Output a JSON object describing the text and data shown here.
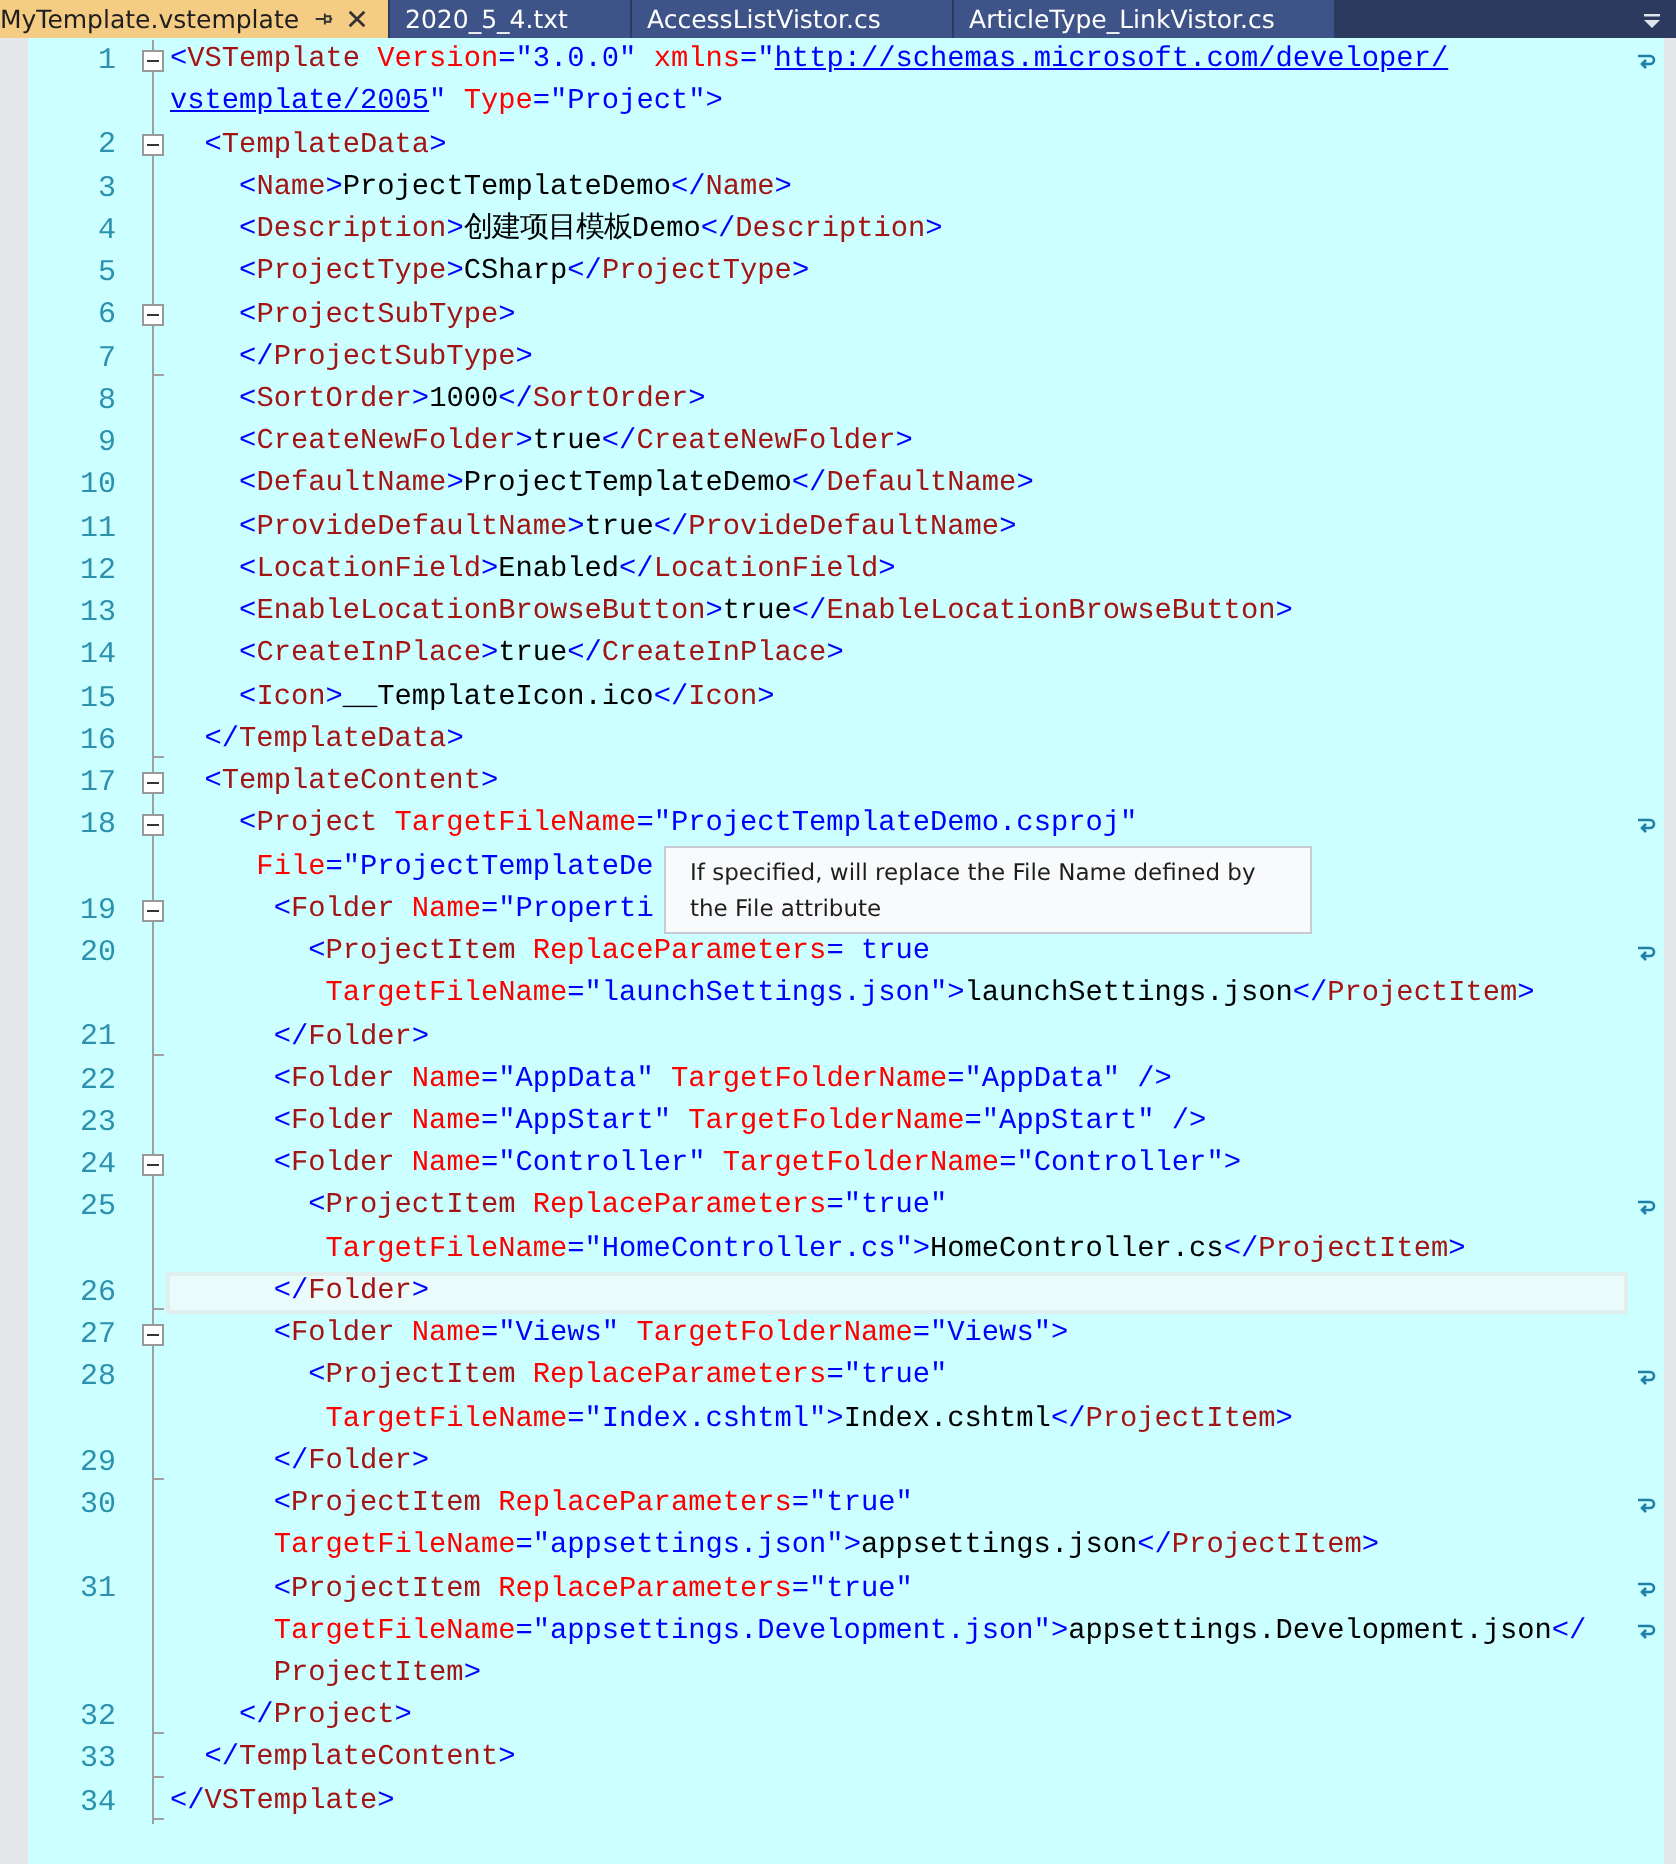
{
  "tabs": [
    {
      "label": "MyTemplate.vstemplate",
      "selected": true
    },
    {
      "label": "2020_5_4.txt",
      "selected": false
    },
    {
      "label": "AccessListVistor.cs",
      "selected": false
    },
    {
      "label": "ArticleType_LinkVistor.cs",
      "selected": false
    }
  ],
  "lines": [
    {
      "n": "1",
      "kind": "open",
      "current": false,
      "rows": [
        {
          "tokens": [
            {
              "kind": "punct",
              "text": "<"
            },
            {
              "kind": "element",
              "text": "VSTemplate"
            },
            {
              "kind": "attr",
              "text": " Version"
            },
            {
              "kind": "punct",
              "text": "="
            },
            {
              "kind": "value",
              "text": "\"3.0.0\""
            },
            {
              "kind": "attr",
              "text": " xmlns"
            },
            {
              "kind": "punct",
              "text": "="
            },
            {
              "kind": "value",
              "text": "\""
            },
            {
              "kind": "link",
              "text": "http://schemas.microsoft.com/developer/"
            }
          ]
        },
        {
          "tokens": [
            {
              "kind": "link",
              "text": "vstemplate/2005"
            },
            {
              "kind": "value",
              "text": "\""
            },
            {
              "kind": "attr",
              "text": " Type"
            },
            {
              "kind": "punct",
              "text": "="
            },
            {
              "kind": "value",
              "text": "\"Project\""
            },
            {
              "kind": "punct",
              "text": ">"
            }
          ]
        }
      ]
    },
    {
      "n": "2",
      "kind": "open",
      "current": false,
      "rows": [
        {
          "tokens": [
            {
              "kind": "punct",
              "text": "  <"
            },
            {
              "kind": "element",
              "text": "TemplateData"
            },
            {
              "kind": "punct",
              "text": ">"
            }
          ]
        }
      ]
    },
    {
      "n": "3",
      "kind": "plain",
      "current": false,
      "rows": [
        {
          "tokens": [
            {
              "kind": "punct",
              "text": "    <"
            },
            {
              "kind": "element",
              "text": "Name"
            },
            {
              "kind": "punct",
              "text": ">"
            },
            {
              "kind": "text",
              "text": "ProjectTemplateDemo"
            },
            {
              "kind": "punct",
              "text": "</"
            },
            {
              "kind": "element",
              "text": "Name"
            },
            {
              "kind": "punct",
              "text": ">"
            }
          ]
        }
      ]
    },
    {
      "n": "4",
      "kind": "plain",
      "current": false,
      "rows": [
        {
          "tokens": [
            {
              "kind": "punct",
              "text": "    <"
            },
            {
              "kind": "element",
              "text": "Description"
            },
            {
              "kind": "punct",
              "text": ">"
            },
            {
              "kind": "text",
              "text": "创建项目模板Demo"
            },
            {
              "kind": "punct",
              "text": "</"
            },
            {
              "kind": "element",
              "text": "Description"
            },
            {
              "kind": "punct",
              "text": ">"
            }
          ]
        }
      ]
    },
    {
      "n": "5",
      "kind": "plain",
      "current": false,
      "rows": [
        {
          "tokens": [
            {
              "kind": "punct",
              "text": "    <"
            },
            {
              "kind": "element",
              "text": "ProjectType"
            },
            {
              "kind": "punct",
              "text": ">"
            },
            {
              "kind": "text",
              "text": "CSharp"
            },
            {
              "kind": "punct",
              "text": "</"
            },
            {
              "kind": "element",
              "text": "ProjectType"
            },
            {
              "kind": "punct",
              "text": ">"
            }
          ]
        }
      ]
    },
    {
      "n": "6",
      "kind": "open",
      "current": false,
      "rows": [
        {
          "tokens": [
            {
              "kind": "punct",
              "text": "    <"
            },
            {
              "kind": "element",
              "text": "ProjectSubType"
            },
            {
              "kind": "punct",
              "text": ">"
            }
          ]
        }
      ]
    },
    {
      "n": "7",
      "kind": "close",
      "current": false,
      "rows": [
        {
          "tokens": [
            {
              "kind": "punct",
              "text": "    </"
            },
            {
              "kind": "element",
              "text": "ProjectSubType"
            },
            {
              "kind": "punct",
              "text": ">"
            }
          ]
        }
      ]
    },
    {
      "n": "8",
      "kind": "plain",
      "current": false,
      "rows": [
        {
          "tokens": [
            {
              "kind": "punct",
              "text": "    <"
            },
            {
              "kind": "element",
              "text": "SortOrder"
            },
            {
              "kind": "punct",
              "text": ">"
            },
            {
              "kind": "text",
              "text": "1000"
            },
            {
              "kind": "punct",
              "text": "</"
            },
            {
              "kind": "element",
              "text": "SortOrder"
            },
            {
              "kind": "punct",
              "text": ">"
            }
          ]
        }
      ]
    },
    {
      "n": "9",
      "kind": "plain",
      "current": false,
      "rows": [
        {
          "tokens": [
            {
              "kind": "punct",
              "text": "    <"
            },
            {
              "kind": "element",
              "text": "CreateNewFolder"
            },
            {
              "kind": "punct",
              "text": ">"
            },
            {
              "kind": "text",
              "text": "true"
            },
            {
              "kind": "punct",
              "text": "</"
            },
            {
              "kind": "element",
              "text": "CreateNewFolder"
            },
            {
              "kind": "punct",
              "text": ">"
            }
          ]
        }
      ]
    },
    {
      "n": "10",
      "kind": "plain",
      "current": false,
      "rows": [
        {
          "tokens": [
            {
              "kind": "punct",
              "text": "    <"
            },
            {
              "kind": "element",
              "text": "DefaultName"
            },
            {
              "kind": "punct",
              "text": ">"
            },
            {
              "kind": "text",
              "text": "ProjectTemplateDemo"
            },
            {
              "kind": "punct",
              "text": "</"
            },
            {
              "kind": "element",
              "text": "DefaultName"
            },
            {
              "kind": "punct",
              "text": ">"
            }
          ]
        }
      ]
    },
    {
      "n": "11",
      "kind": "plain",
      "current": false,
      "rows": [
        {
          "tokens": [
            {
              "kind": "punct",
              "text": "    <"
            },
            {
              "kind": "element",
              "text": "ProvideDefaultName"
            },
            {
              "kind": "punct",
              "text": ">"
            },
            {
              "kind": "text",
              "text": "true"
            },
            {
              "kind": "punct",
              "text": "</"
            },
            {
              "kind": "element",
              "text": "ProvideDefaultName"
            },
            {
              "kind": "punct",
              "text": ">"
            }
          ]
        }
      ]
    },
    {
      "n": "12",
      "kind": "plain",
      "current": false,
      "rows": [
        {
          "tokens": [
            {
              "kind": "punct",
              "text": "    <"
            },
            {
              "kind": "element",
              "text": "LocationField"
            },
            {
              "kind": "punct",
              "text": ">"
            },
            {
              "kind": "text",
              "text": "Enabled"
            },
            {
              "kind": "punct",
              "text": "</"
            },
            {
              "kind": "element",
              "text": "LocationField"
            },
            {
              "kind": "punct",
              "text": ">"
            }
          ]
        }
      ]
    },
    {
      "n": "13",
      "kind": "plain",
      "current": false,
      "rows": [
        {
          "tokens": [
            {
              "kind": "punct",
              "text": "    <"
            },
            {
              "kind": "element",
              "text": "EnableLocationBrowseButton"
            },
            {
              "kind": "punct",
              "text": ">"
            },
            {
              "kind": "text",
              "text": "true"
            },
            {
              "kind": "punct",
              "text": "</"
            },
            {
              "kind": "element",
              "text": "EnableLocationBrowseButton"
            },
            {
              "kind": "punct",
              "text": ">"
            }
          ]
        }
      ]
    },
    {
      "n": "14",
      "kind": "plain",
      "current": false,
      "rows": [
        {
          "tokens": [
            {
              "kind": "punct",
              "text": "    <"
            },
            {
              "kind": "element",
              "text": "CreateInPlace"
            },
            {
              "kind": "punct",
              "text": ">"
            },
            {
              "kind": "text",
              "text": "true"
            },
            {
              "kind": "punct",
              "text": "</"
            },
            {
              "kind": "element",
              "text": "CreateInPlace"
            },
            {
              "kind": "punct",
              "text": ">"
            }
          ]
        }
      ]
    },
    {
      "n": "15",
      "kind": "plain",
      "current": false,
      "rows": [
        {
          "tokens": [
            {
              "kind": "punct",
              "text": "    <"
            },
            {
              "kind": "element",
              "text": "Icon"
            },
            {
              "kind": "punct",
              "text": ">"
            },
            {
              "kind": "text",
              "text": "__TemplateIcon.ico"
            },
            {
              "kind": "punct",
              "text": "</"
            },
            {
              "kind": "element",
              "text": "Icon"
            },
            {
              "kind": "punct",
              "text": ">"
            }
          ]
        }
      ]
    },
    {
      "n": "16",
      "kind": "close",
      "current": false,
      "rows": [
        {
          "tokens": [
            {
              "kind": "punct",
              "text": "  </"
            },
            {
              "kind": "element",
              "text": "TemplateData"
            },
            {
              "kind": "punct",
              "text": ">"
            }
          ]
        }
      ]
    },
    {
      "n": "17",
      "kind": "open",
      "current": false,
      "rows": [
        {
          "tokens": [
            {
              "kind": "punct",
              "text": "  <"
            },
            {
              "kind": "element",
              "text": "TemplateContent"
            },
            {
              "kind": "punct",
              "text": ">"
            }
          ]
        }
      ]
    },
    {
      "n": "18",
      "kind": "open",
      "current": false,
      "rows": [
        {
          "tokens": [
            {
              "kind": "punct",
              "text": "    <"
            },
            {
              "kind": "element",
              "text": "Project"
            },
            {
              "kind": "attr",
              "text": " TargetFileName"
            },
            {
              "kind": "punct",
              "text": "="
            },
            {
              "kind": "value",
              "text": "\"ProjectTemplateDemo.csproj\""
            }
          ]
        },
        {
          "tokens": [
            {
              "kind": "attr",
              "text": "     File"
            },
            {
              "kind": "punct",
              "text": "="
            },
            {
              "kind": "value",
              "text": "\"ProjectTemplateDe"
            }
          ]
        }
      ]
    },
    {
      "n": "19",
      "kind": "open",
      "current": false,
      "rows": [
        {
          "tokens": [
            {
              "kind": "punct",
              "text": "      <"
            },
            {
              "kind": "element",
              "text": "Folder"
            },
            {
              "kind": "attr",
              "text": " Name"
            },
            {
              "kind": "punct",
              "text": "="
            },
            {
              "kind": "value",
              "text": "\"Properti"
            }
          ]
        }
      ]
    },
    {
      "n": "20",
      "kind": "plain",
      "current": false,
      "rows": [
        {
          "tokens": [
            {
              "kind": "punct",
              "text": "        <"
            },
            {
              "kind": "element",
              "text": "ProjectItem"
            },
            {
              "kind": "attr",
              "text": " ReplaceParameters"
            },
            {
              "kind": "punct",
              "text": "="
            },
            {
              "kind": "value",
              "text": " true"
            }
          ]
        },
        {
          "tokens": [
            {
              "kind": "attr",
              "text": "         TargetFileName"
            },
            {
              "kind": "punct",
              "text": "="
            },
            {
              "kind": "value",
              "text": "\"launchSettings.json\""
            },
            {
              "kind": "punct",
              "text": ">"
            },
            {
              "kind": "text",
              "text": "launchSettings.json"
            },
            {
              "kind": "punct",
              "text": "</"
            },
            {
              "kind": "element",
              "text": "ProjectItem"
            },
            {
              "kind": "punct",
              "text": ">"
            }
          ]
        }
      ]
    },
    {
      "n": "21",
      "kind": "close",
      "current": false,
      "rows": [
        {
          "tokens": [
            {
              "kind": "punct",
              "text": "      </"
            },
            {
              "kind": "element",
              "text": "Folder"
            },
            {
              "kind": "punct",
              "text": ">"
            }
          ]
        }
      ]
    },
    {
      "n": "22",
      "kind": "plain",
      "current": false,
      "rows": [
        {
          "tokens": [
            {
              "kind": "punct",
              "text": "      <"
            },
            {
              "kind": "element",
              "text": "Folder"
            },
            {
              "kind": "attr",
              "text": " Name"
            },
            {
              "kind": "punct",
              "text": "="
            },
            {
              "kind": "value",
              "text": "\"AppData\""
            },
            {
              "kind": "attr",
              "text": " TargetFolderName"
            },
            {
              "kind": "punct",
              "text": "="
            },
            {
              "kind": "value",
              "text": "\"AppData\""
            },
            {
              "kind": "punct",
              "text": " />"
            }
          ]
        }
      ]
    },
    {
      "n": "23",
      "kind": "plain",
      "current": false,
      "rows": [
        {
          "tokens": [
            {
              "kind": "punct",
              "text": "      <"
            },
            {
              "kind": "element",
              "text": "Folder"
            },
            {
              "kind": "attr",
              "text": " Name"
            },
            {
              "kind": "punct",
              "text": "="
            },
            {
              "kind": "value",
              "text": "\"AppStart\""
            },
            {
              "kind": "attr",
              "text": " TargetFolderName"
            },
            {
              "kind": "punct",
              "text": "="
            },
            {
              "kind": "value",
              "text": "\"AppStart\""
            },
            {
              "kind": "punct",
              "text": " />"
            }
          ]
        }
      ]
    },
    {
      "n": "24",
      "kind": "open",
      "current": false,
      "rows": [
        {
          "tokens": [
            {
              "kind": "punct",
              "text": "      <"
            },
            {
              "kind": "element",
              "text": "Folder"
            },
            {
              "kind": "attr",
              "text": " Name"
            },
            {
              "kind": "punct",
              "text": "="
            },
            {
              "kind": "value",
              "text": "\"Controller\""
            },
            {
              "kind": "attr",
              "text": " TargetFolderName"
            },
            {
              "kind": "punct",
              "text": "="
            },
            {
              "kind": "value",
              "text": "\"Controller\""
            },
            {
              "kind": "punct",
              "text": ">"
            }
          ]
        }
      ]
    },
    {
      "n": "25",
      "kind": "plain",
      "current": false,
      "rows": [
        {
          "tokens": [
            {
              "kind": "punct",
              "text": "        <"
            },
            {
              "kind": "element",
              "text": "ProjectItem"
            },
            {
              "kind": "attr",
              "text": " ReplaceParameters"
            },
            {
              "kind": "punct",
              "text": "="
            },
            {
              "kind": "value",
              "text": "\"true\""
            }
          ]
        },
        {
          "tokens": [
            {
              "kind": "attr",
              "text": "         TargetFileName"
            },
            {
              "kind": "punct",
              "text": "="
            },
            {
              "kind": "value",
              "text": "\"HomeController.cs\""
            },
            {
              "kind": "punct",
              "text": ">"
            },
            {
              "kind": "text",
              "text": "HomeController.cs"
            },
            {
              "kind": "punct",
              "text": "</"
            },
            {
              "kind": "element",
              "text": "ProjectItem"
            },
            {
              "kind": "punct",
              "text": ">"
            }
          ]
        }
      ]
    },
    {
      "n": "26",
      "kind": "close",
      "current": true,
      "rows": [
        {
          "tokens": [
            {
              "kind": "punct",
              "text": "      </"
            },
            {
              "kind": "element",
              "text": "Folder"
            },
            {
              "kind": "punct",
              "text": ">"
            }
          ]
        }
      ]
    },
    {
      "n": "27",
      "kind": "open",
      "current": false,
      "rows": [
        {
          "tokens": [
            {
              "kind": "punct",
              "text": "      <"
            },
            {
              "kind": "element",
              "text": "Folder"
            },
            {
              "kind": "attr",
              "text": " Name"
            },
            {
              "kind": "punct",
              "text": "="
            },
            {
              "kind": "value",
              "text": "\"Views\""
            },
            {
              "kind": "attr",
              "text": " TargetFolderName"
            },
            {
              "kind": "punct",
              "text": "="
            },
            {
              "kind": "value",
              "text": "\"Views\""
            },
            {
              "kind": "punct",
              "text": ">"
            }
          ]
        }
      ]
    },
    {
      "n": "28",
      "kind": "plain",
      "current": false,
      "rows": [
        {
          "tokens": [
            {
              "kind": "punct",
              "text": "        <"
            },
            {
              "kind": "element",
              "text": "ProjectItem"
            },
            {
              "kind": "attr",
              "text": " ReplaceParameters"
            },
            {
              "kind": "punct",
              "text": "="
            },
            {
              "kind": "value",
              "text": "\"true\""
            }
          ]
        },
        {
          "tokens": [
            {
              "kind": "attr",
              "text": "         TargetFileName"
            },
            {
              "kind": "punct",
              "text": "="
            },
            {
              "kind": "value",
              "text": "\"Index.cshtml\""
            },
            {
              "kind": "punct",
              "text": ">"
            },
            {
              "kind": "text",
              "text": "Index.cshtml"
            },
            {
              "kind": "punct",
              "text": "</"
            },
            {
              "kind": "element",
              "text": "ProjectItem"
            },
            {
              "kind": "punct",
              "text": ">"
            }
          ]
        }
      ]
    },
    {
      "n": "29",
      "kind": "close",
      "current": false,
      "rows": [
        {
          "tokens": [
            {
              "kind": "punct",
              "text": "      </"
            },
            {
              "kind": "element",
              "text": "Folder"
            },
            {
              "kind": "punct",
              "text": ">"
            }
          ]
        }
      ]
    },
    {
      "n": "30",
      "kind": "plain",
      "current": false,
      "rows": [
        {
          "tokens": [
            {
              "kind": "punct",
              "text": "      <"
            },
            {
              "kind": "element",
              "text": "ProjectItem"
            },
            {
              "kind": "attr",
              "text": " ReplaceParameters"
            },
            {
              "kind": "punct",
              "text": "="
            },
            {
              "kind": "value",
              "text": "\"true\""
            }
          ]
        },
        {
          "tokens": [
            {
              "kind": "attr",
              "text": "      TargetFileName"
            },
            {
              "kind": "punct",
              "text": "="
            },
            {
              "kind": "value",
              "text": "\"appsettings.json\""
            },
            {
              "kind": "punct",
              "text": ">"
            },
            {
              "kind": "text",
              "text": "appsettings.json"
            },
            {
              "kind": "punct",
              "text": "</"
            },
            {
              "kind": "element",
              "text": "ProjectItem"
            },
            {
              "kind": "punct",
              "text": ">"
            }
          ]
        }
      ]
    },
    {
      "n": "31",
      "kind": "plain",
      "current": false,
      "rows": [
        {
          "tokens": [
            {
              "kind": "punct",
              "text": "      <"
            },
            {
              "kind": "element",
              "text": "ProjectItem"
            },
            {
              "kind": "attr",
              "text": " ReplaceParameters"
            },
            {
              "kind": "punct",
              "text": "="
            },
            {
              "kind": "value",
              "text": "\"true\""
            }
          ]
        },
        {
          "tokens": [
            {
              "kind": "attr",
              "text": "      TargetFileName"
            },
            {
              "kind": "punct",
              "text": "="
            },
            {
              "kind": "value",
              "text": "\"appsettings.Development.json\""
            },
            {
              "kind": "punct",
              "text": ">"
            },
            {
              "kind": "text",
              "text": "appsettings.Development.json"
            },
            {
              "kind": "punct",
              "text": "</"
            }
          ]
        },
        {
          "tokens": [
            {
              "kind": "element",
              "text": "      ProjectItem"
            },
            {
              "kind": "punct",
              "text": ">"
            }
          ]
        }
      ]
    },
    {
      "n": "32",
      "kind": "close",
      "current": false,
      "rows": [
        {
          "tokens": [
            {
              "kind": "punct",
              "text": "    </"
            },
            {
              "kind": "element",
              "text": "Project"
            },
            {
              "kind": "punct",
              "text": ">"
            }
          ]
        }
      ]
    },
    {
      "n": "33",
      "kind": "close",
      "current": false,
      "rows": [
        {
          "tokens": [
            {
              "kind": "punct",
              "text": "  </"
            },
            {
              "kind": "element",
              "text": "TemplateContent"
            },
            {
              "kind": "punct",
              "text": ">"
            }
          ]
        }
      ]
    },
    {
      "n": "34",
      "kind": "close",
      "current": false,
      "rows": [
        {
          "tokens": [
            {
              "kind": "punct",
              "text": "</"
            },
            {
              "kind": "element",
              "text": "VSTemplate"
            },
            {
              "kind": "punct",
              "text": ">"
            }
          ]
        }
      ]
    }
  ],
  "tooltip": {
    "text": "If specified, will replace the File Name defined by the File attribute"
  }
}
